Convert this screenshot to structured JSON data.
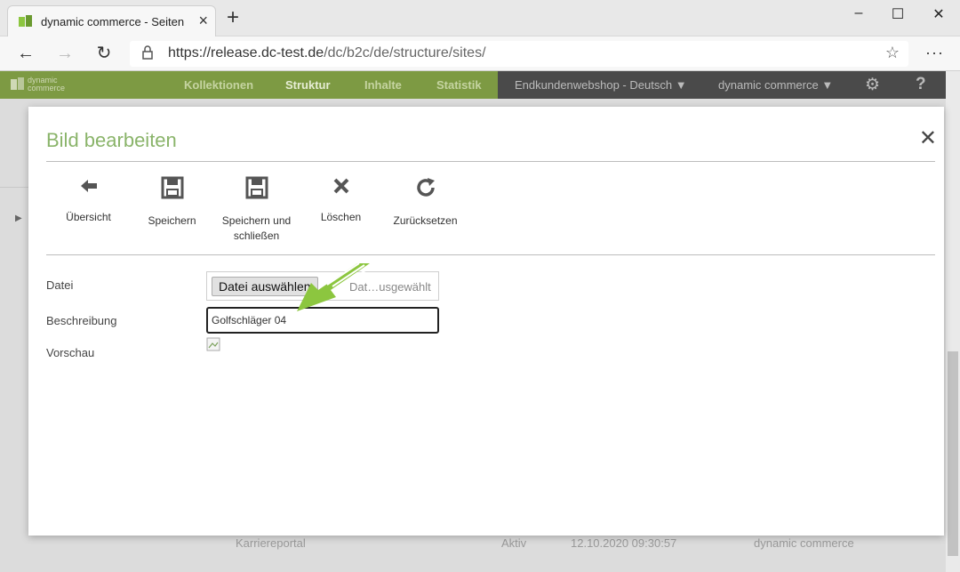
{
  "browser": {
    "tab_title": "dynamic commerce - Seiten",
    "url_host": "https://release.dc-test.de",
    "url_path": "/dc/b2c/de/structure/sites/"
  },
  "app": {
    "logo_line1": "dynamic",
    "logo_line2": "commerce",
    "nav": [
      {
        "label": "Kollektionen"
      },
      {
        "label": "Struktur"
      },
      {
        "label": "Inhalte"
      },
      {
        "label": "Statistik"
      }
    ],
    "shop_select": "Endkundenwebshop - Deutsch",
    "tenant_select": "dynamic commerce",
    "help": "?"
  },
  "background_row": {
    "name": "Karriereportal",
    "status": "Aktiv",
    "date": "12.10.2020 09:30:57",
    "owner": "dynamic commerce"
  },
  "modal": {
    "title": "Bild bearbeiten",
    "toolbar": [
      {
        "label": "Übersicht",
        "icon": "arrow-left-icon"
      },
      {
        "label": "Speichern",
        "icon": "save-icon"
      },
      {
        "label": "Speichern und schließen",
        "icon": "save-close-icon"
      },
      {
        "label": "Löschen",
        "icon": "delete-icon"
      },
      {
        "label": "Zurücksetzen",
        "icon": "reset-icon"
      }
    ],
    "form": {
      "file_label": "Datei",
      "file_button": "Datei auswählen",
      "file_status": "Dat…usgewählt",
      "description_label": "Beschreibung",
      "description_value": "Golfschläger 04",
      "preview_label": "Vorschau"
    }
  },
  "colors": {
    "accent_green": "#7d9a43",
    "title_green": "#8ab46a",
    "annotation_green": "#8cc63f"
  }
}
